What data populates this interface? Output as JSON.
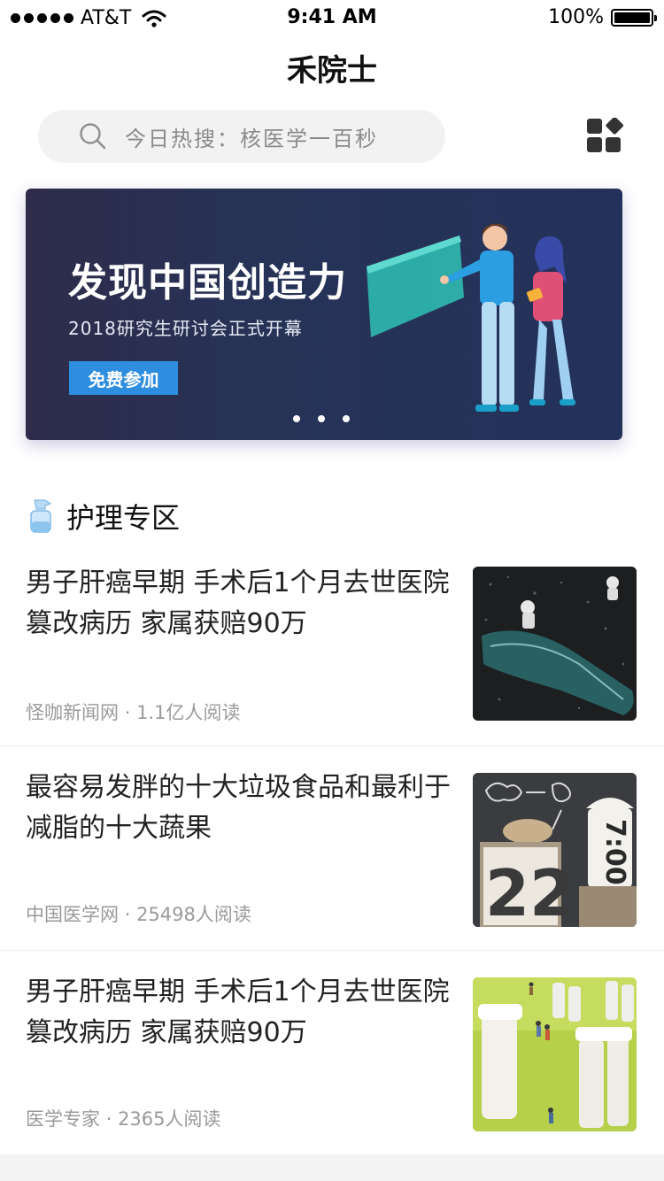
{
  "status_bar": {
    "carrier": "AT&T",
    "time": "9:41 AM",
    "battery": "100%",
    "battery_level": 1.0
  },
  "nav": {
    "title": "禾院士"
  },
  "search": {
    "placeholder": "今日热搜：核医学一百秒",
    "icon": "search-icon"
  },
  "banner": {
    "title": "发现中国创造力",
    "subtitle": "2018研究生研讨会正式开幕",
    "button_label": "免费参加",
    "page_count": 3,
    "active_page": 1,
    "colors": {
      "background": "#263357",
      "button": "#2d8ee0"
    }
  },
  "section": {
    "title": "护理专区",
    "icon": "spray-bottle-icon"
  },
  "articles": [
    {
      "title": "男子肝癌早期 手术后1个月去世医院篡改病历 家属获赔90万",
      "source": "怪咖新闻网",
      "reads": "1.1亿人阅读",
      "thumb": "bottle-astronaut-image"
    },
    {
      "title": "最容易发胖的十大垃圾食品和最利于减脂的十大蔬果",
      "source": "中国医学网",
      "reads": "25498人阅读",
      "thumb": "calendar-chalkboard-image"
    },
    {
      "title": "男子肝癌早期 手术后1个月去世医院篡改病历 家属获赔90万",
      "source": "医学专家",
      "reads": "2365人阅读",
      "thumb": "miniature-stonehenge-image"
    }
  ],
  "meta_separator": "·"
}
